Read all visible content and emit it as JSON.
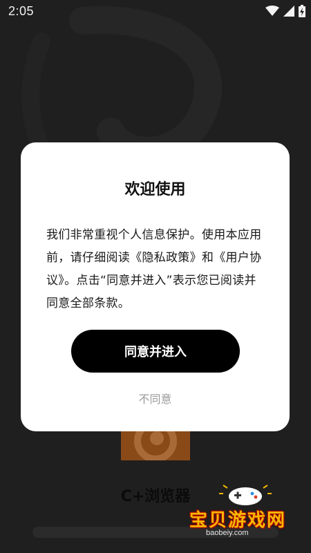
{
  "status_bar": {
    "time": "2:05",
    "icons": [
      "wifi-icon",
      "signal-icon",
      "battery-charging-icon"
    ]
  },
  "dialog": {
    "title": "欢迎使用",
    "body": "我们非常重视个人信息保护。使用本应用前，请仔细阅读《隐私政策》和《用户协议》。点击“同意并进入”表示您已阅读并同意全部条款。",
    "agree_label": "同意并进入",
    "disagree_label": "不同意"
  },
  "background_app": {
    "name": "C+浏览器",
    "icon": "c-plus-browser-logo-icon"
  },
  "watermark": {
    "title": "宝贝游戏网",
    "url": "baobeiy.com"
  },
  "colors": {
    "overlay": "#1f1f1f",
    "dialog_bg": "#ffffff",
    "primary_button": "#000000",
    "secondary_text": "#9a9a9a",
    "app_icon": "#8a4a18",
    "watermark_text": "#f6b800"
  }
}
